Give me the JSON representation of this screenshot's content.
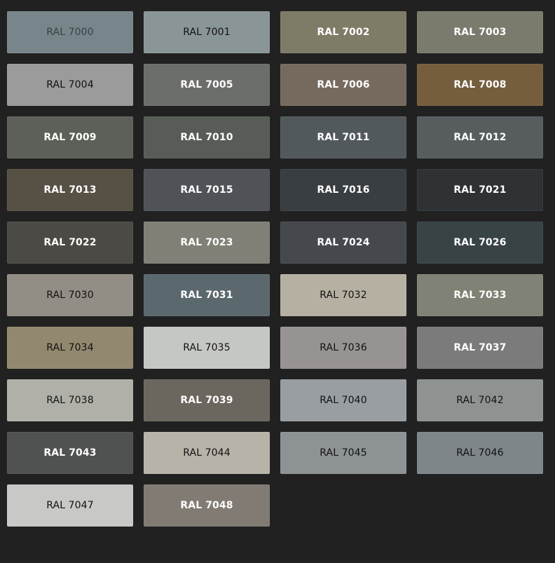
{
  "swatches": [
    {
      "label": "RAL 7000",
      "color": "#78858B",
      "text": "#3A4044"
    },
    {
      "label": "RAL 7001",
      "color": "#8A9597",
      "text": "#111111"
    },
    {
      "label": "RAL 7002",
      "color": "#7E7B67",
      "text": "#FFFFFF"
    },
    {
      "label": "RAL 7003",
      "color": "#7A7B6C",
      "text": "#FFFFFF"
    },
    {
      "label": "RAL 7004",
      "color": "#9B9B9B",
      "text": "#111111"
    },
    {
      "label": "RAL 7005",
      "color": "#6C6E6B",
      "text": "#FFFFFF"
    },
    {
      "label": "RAL 7006",
      "color": "#766A5E",
      "text": "#FFFFFF"
    },
    {
      "label": "RAL 7008",
      "color": "#745E3D",
      "text": "#FFFFFF"
    },
    {
      "label": "RAL 7009",
      "color": "#5D6058",
      "text": "#FFFFFF"
    },
    {
      "label": "RAL 7010",
      "color": "#585C56",
      "text": "#FFFFFF"
    },
    {
      "label": "RAL 7011",
      "color": "#52595D",
      "text": "#FFFFFF"
    },
    {
      "label": "RAL 7012",
      "color": "#575D5E",
      "text": "#FFFFFF"
    },
    {
      "label": "RAL 7013",
      "color": "#575044",
      "text": "#FFFFFF"
    },
    {
      "label": "RAL 7015",
      "color": "#4F5358",
      "text": "#FFFFFF"
    },
    {
      "label": "RAL 7016",
      "color": "#383E42",
      "text": "#FFFFFF"
    },
    {
      "label": "RAL 7021",
      "color": "#2F3234",
      "text": "#FFFFFF"
    },
    {
      "label": "RAL 7022",
      "color": "#4C4A44",
      "text": "#FFFFFF"
    },
    {
      "label": "RAL 7023",
      "color": "#808076",
      "text": "#FFFFFF"
    },
    {
      "label": "RAL 7024",
      "color": "#45494E",
      "text": "#FFFFFF"
    },
    {
      "label": "RAL 7026",
      "color": "#374345",
      "text": "#FFFFFF"
    },
    {
      "label": "RAL 7030",
      "color": "#928E85",
      "text": "#111111"
    },
    {
      "label": "RAL 7031",
      "color": "#5B686D",
      "text": "#FFFFFF"
    },
    {
      "label": "RAL 7032",
      "color": "#B5B0A1",
      "text": "#111111"
    },
    {
      "label": "RAL 7033",
      "color": "#7F8274",
      "text": "#FFFFFF"
    },
    {
      "label": "RAL 7034",
      "color": "#92886F",
      "text": "#111111"
    },
    {
      "label": "RAL 7035",
      "color": "#C5C7C4",
      "text": "#111111"
    },
    {
      "label": "RAL 7036",
      "color": "#979392",
      "text": "#111111"
    },
    {
      "label": "RAL 7037",
      "color": "#7A7B7A",
      "text": "#FFFFFF"
    },
    {
      "label": "RAL 7038",
      "color": "#B0B0A9",
      "text": "#111111"
    },
    {
      "label": "RAL 7039",
      "color": "#6B665E",
      "text": "#FFFFFF"
    },
    {
      "label": "RAL 7040",
      "color": "#989EA1",
      "text": "#111111"
    },
    {
      "label": "RAL 7042",
      "color": "#8E9291",
      "text": "#111111"
    },
    {
      "label": "RAL 7043",
      "color": "#4F5250",
      "text": "#FFFFFF"
    },
    {
      "label": "RAL 7044",
      "color": "#B7B3A8",
      "text": "#111111"
    },
    {
      "label": "RAL 7045",
      "color": "#8D9295",
      "text": "#111111"
    },
    {
      "label": "RAL 7046",
      "color": "#7F868A",
      "text": "#111111"
    },
    {
      "label": "RAL 7047",
      "color": "#C8C8C7",
      "text": "#111111"
    },
    {
      "label": "RAL 7048",
      "color": "#817B73",
      "text": "#FFFFFF"
    }
  ]
}
